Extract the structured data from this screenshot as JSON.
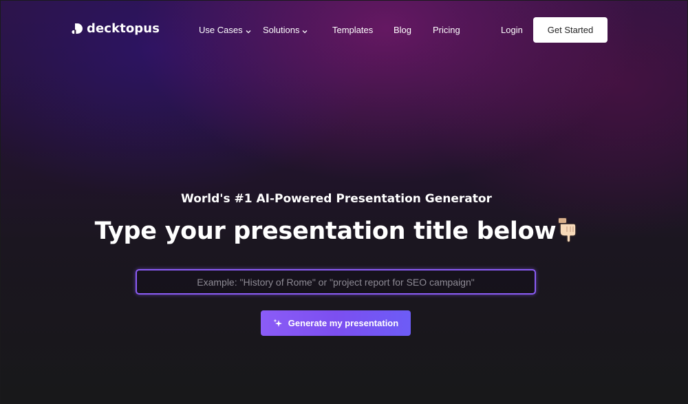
{
  "nav": {
    "logo_text": "decktopus",
    "items": [
      {
        "label": "Use Cases",
        "has_dropdown": true,
        "icon": "chevron-down-icon"
      },
      {
        "label": "Solutions",
        "has_dropdown": true,
        "icon": "chevron-down-icon"
      },
      {
        "label": "Templates",
        "has_dropdown": false
      },
      {
        "label": "Blog",
        "has_dropdown": false
      },
      {
        "label": "Pricing",
        "has_dropdown": false
      }
    ],
    "login_label": "Login",
    "cta_label": "Get Started"
  },
  "hero": {
    "subtitle": "World's #1 AI-Powered Presentation Generator",
    "title": "Type your presentation title below",
    "title_icon": "pointing-down-hand-icon",
    "input_value": "",
    "input_placeholder": "Example: \"History of Rome\" or \"project report for SEO campaign\"",
    "generate_label": "Generate my presentation",
    "generate_icon": "sparkle-icon"
  },
  "colors": {
    "accent": "#8b5cf6",
    "cta_background": "#ffffff",
    "text": "#ffffff"
  }
}
